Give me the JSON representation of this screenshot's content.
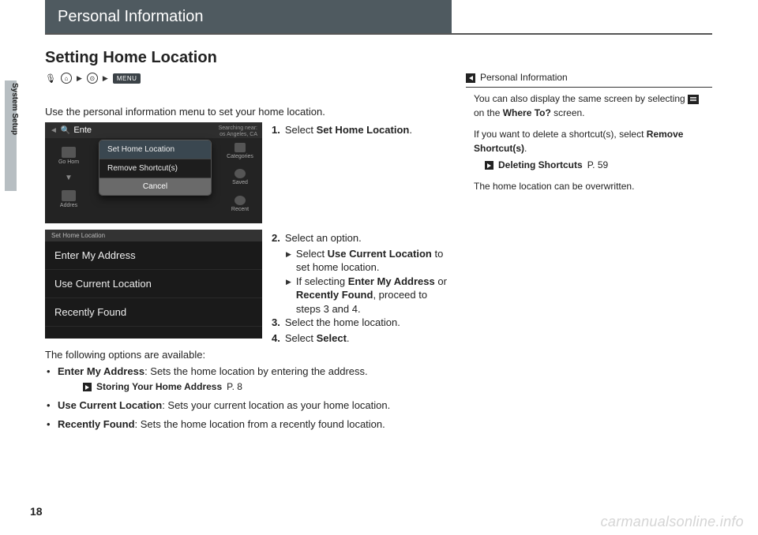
{
  "header": {
    "title": "Personal Information"
  },
  "side_tab": "System Setup",
  "page": {
    "title": "Setting Home Location",
    "crumb_menu": "MENU",
    "intro": "Use the personal information menu to set your home location.",
    "options_intro": "The following options are available:",
    "number": "18"
  },
  "shot1": {
    "enter": "Ente",
    "searching": "Searching near:",
    "searching_sub": "os Angeles, CA",
    "left_home": "Go Hom",
    "left_addr": "Addres",
    "popup_set": "Set Home Location",
    "popup_remove": "Remove Shortcut(s)",
    "popup_cancel": "Cancel",
    "r_cat": "Categories",
    "r_saved": "Saved",
    "r_recent": "Recent"
  },
  "shot2": {
    "hdr": "Set Home Location",
    "o1": "Enter My Address",
    "o2": "Use Current Location",
    "o3": "Recently Found"
  },
  "steps": {
    "s1_num": "1.",
    "s1": "Select ",
    "s1_b": "Set Home Location",
    "s1_end": ".",
    "s2_num": "2.",
    "s2": "Select an option.",
    "s2a_pre": "Select ",
    "s2a_b": "Use Current Location",
    "s2a_post": " to set home location.",
    "s2b_pre": "If selecting ",
    "s2b_b1": "Enter My Address",
    "s2b_mid": " or ",
    "s2b_b2": "Recently Found",
    "s2b_post": ", proceed to steps 3 and 4.",
    "s3_num": "3.",
    "s3": "Select the home location.",
    "s4_num": "4.",
    "s4_pre": "Select ",
    "s4_b": "Select",
    "s4_end": "."
  },
  "bullets": {
    "b1_b": "Enter My Address",
    "b1": ": Sets the home location by entering the address.",
    "b1_xref": "Storing Your Home Address",
    "b1_xref_p": " P. 8",
    "b2_b": "Use Current Location",
    "b2": ": Sets your current location as your home location.",
    "b3_b": "Recently Found",
    "b3": ": Sets the home location from a recently found location."
  },
  "sidebar": {
    "head": "Personal Information",
    "p1_a": "You can also display the same screen by selecting ",
    "p1_b": " on the ",
    "p1_c": "Where To?",
    "p1_d": " screen.",
    "p2_a": "If you want to delete a shortcut(s), select ",
    "p2_b": "Remove Shortcut(s)",
    "p2_c": ".",
    "xref": "Deleting Shortcuts",
    "xref_p": " P. 59",
    "p3": "The home location can be overwritten."
  },
  "watermark": "carmanualsonline.info"
}
